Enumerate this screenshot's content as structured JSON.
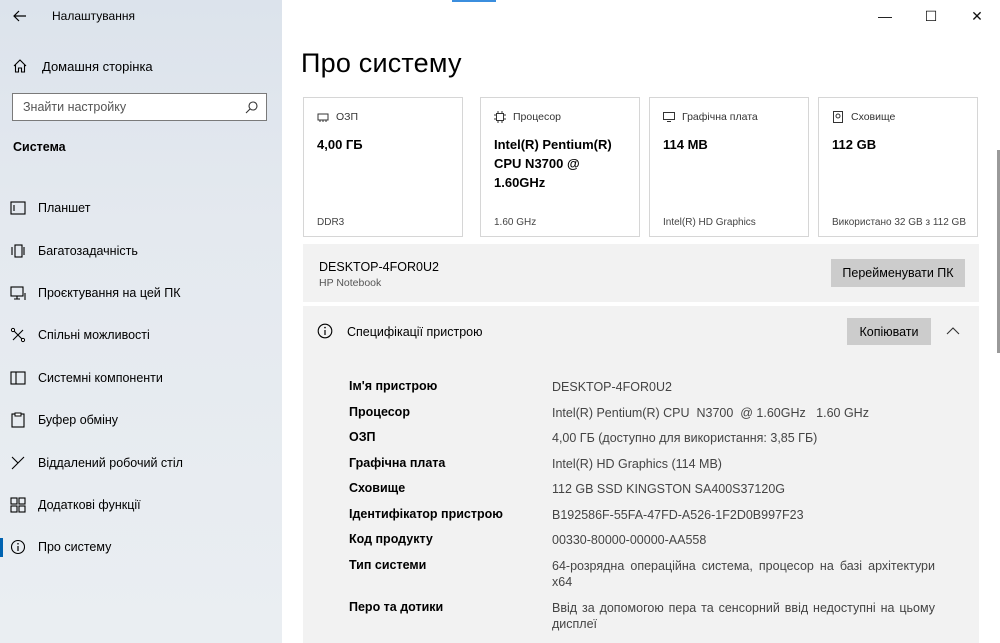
{
  "window": {
    "app_title": "Налаштування",
    "controls": {
      "minimize": "—",
      "maximize": "☐",
      "close": "✕"
    }
  },
  "sidebar": {
    "home_label": "Домашня сторінка",
    "search_placeholder": "Знайти настройку",
    "section_title": "Система",
    "items": [
      {
        "label": "Планшет",
        "icon": "tablet-icon",
        "active": false
      },
      {
        "label": "Багатозадачність",
        "icon": "multitasking-icon",
        "active": false
      },
      {
        "label": "Проєктування на цей ПК",
        "icon": "projecting-icon",
        "active": false
      },
      {
        "label": "Спільні можливості",
        "icon": "shared-experiences-icon",
        "active": false
      },
      {
        "label": "Системні компоненти",
        "icon": "system-components-icon",
        "active": false
      },
      {
        "label": "Буфер обміну",
        "icon": "clipboard-icon",
        "active": false
      },
      {
        "label": "Віддалений робочий стіл",
        "icon": "remote-desktop-icon",
        "active": false
      },
      {
        "label": "Додаткові функції",
        "icon": "optional-features-icon",
        "active": false
      },
      {
        "label": "Про систему",
        "icon": "info-icon",
        "active": true
      }
    ]
  },
  "main": {
    "page_title": "Про систему",
    "cards": [
      {
        "title": "ОЗП",
        "icon": "ram-icon",
        "value": "4,00 ГБ",
        "footer": "DDR3"
      },
      {
        "title": "Процесор",
        "icon": "processor-icon",
        "value": "Intel(R) Pentium(R) CPU  N3700  @ 1.60GHz",
        "footer": "1.60 GHz"
      },
      {
        "title": "Графічна плата",
        "icon": "graphics-icon",
        "value": "114 MB",
        "footer": "Intel(R) HD Graphics"
      },
      {
        "title": "Сховище",
        "icon": "storage-icon",
        "value": "112 GB",
        "footer": "Використано 32 GB з 112 GB"
      }
    ],
    "device": {
      "name": "DESKTOP-4FOR0U2",
      "model": "HP Notebook",
      "rename_label": "Перейменувати ПК"
    },
    "specs": {
      "title": "Специфікації пристрою",
      "copy_label": "Копіювати",
      "rows": [
        {
          "key": "Ім'я пристрою",
          "value": "DESKTOP-4FOR0U2"
        },
        {
          "key": "Процесор",
          "value": "Intel(R) Pentium(R) CPU  N3700  @ 1.60GHz   1.60 GHz"
        },
        {
          "key": "ОЗП",
          "value": "4,00 ГБ (доступно для використання: 3,85 ГБ)"
        },
        {
          "key": "Графічна плата",
          "value": "Intel(R) HD Graphics (114 MB)"
        },
        {
          "key": "Сховище",
          "value": "112 GB SSD KINGSTON SA400S37120G"
        },
        {
          "key": "Ідентифікатор пристрою",
          "value": "B192586F-55FA-47FD-A526-1F2D0B997F23"
        },
        {
          "key": "Код продукту",
          "value": "00330-80000-00000-AA558"
        },
        {
          "key": "Тип системи",
          "value": "64-розрядна операційна система, процесор на базі архітектури x64"
        },
        {
          "key": "Перо та дотики",
          "value": "Ввід за допомогою пера та сенсорний ввід недоступні на цьому дисплеї"
        }
      ]
    }
  },
  "colors": {
    "accent": "#0063b1",
    "sidebar_bg": "#e4e9ef",
    "panel_bg": "#f2f2f2",
    "button_bg": "#cccccc"
  }
}
